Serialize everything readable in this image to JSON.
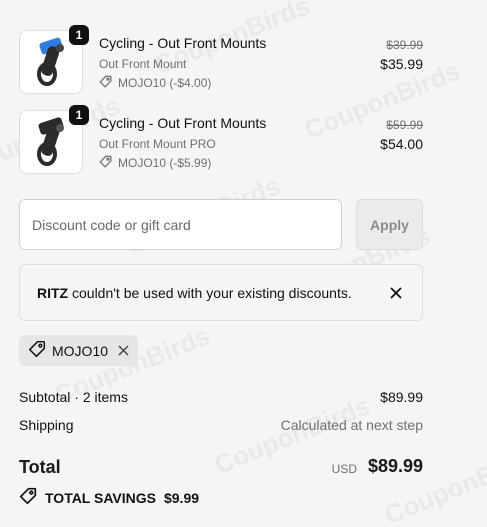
{
  "items": [
    {
      "quantity": "1",
      "title": "Cycling - Out Front Mounts",
      "variant": "Out Front Mount",
      "discount": "MOJO10 (-$4.00)",
      "original_price": "$39.99",
      "price": "$35.99"
    },
    {
      "quantity": "1",
      "title": "Cycling - Out Front Mounts",
      "variant": "Out Front Mount PRO",
      "discount": "MOJO10 (-$5.99)",
      "original_price": "$59.99",
      "price": "$54.00"
    }
  ],
  "discount_form": {
    "placeholder": "Discount code or gift card",
    "apply_label": "Apply"
  },
  "alert": {
    "code": "RITZ",
    "message": "couldn't be used with your existing discounts."
  },
  "applied_code": "MOJO10",
  "summary": {
    "subtotal_label": "Subtotal · 2 items",
    "subtotal_value": "$89.99",
    "shipping_label": "Shipping",
    "shipping_value": "Calculated at next step",
    "total_label": "Total",
    "currency": "USD",
    "total_value": "$89.99",
    "savings_label": "TOTAL SAVINGS",
    "savings_value": "$9.99"
  },
  "watermark": "CouponBirds",
  "icons": {
    "tag": "tag-icon",
    "close": "close-icon"
  },
  "colors": {
    "background": "#f5f5f5",
    "text": "#111111",
    "muted": "#707070",
    "badge": "#111111",
    "product_accent": "#2f7de1"
  }
}
